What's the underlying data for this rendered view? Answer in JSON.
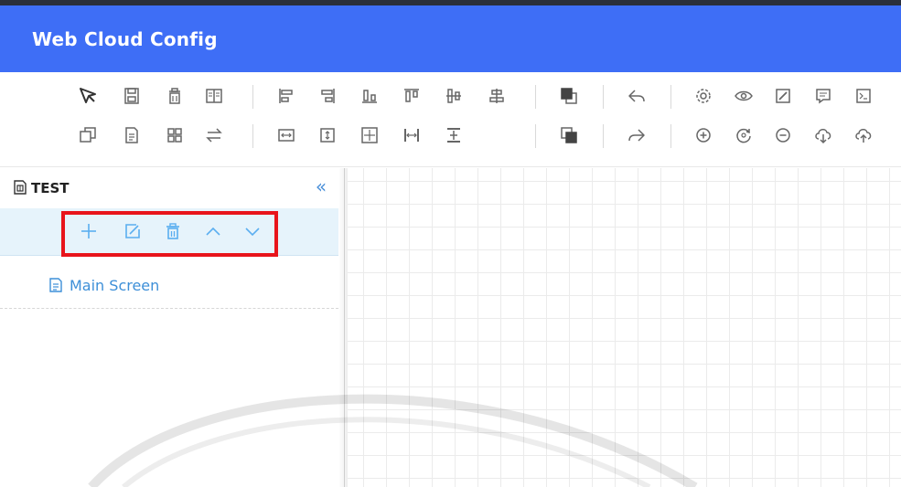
{
  "app": {
    "title": "Web Cloud Config",
    "accent": "#3e6ef6"
  },
  "toolbar": {
    "row1": [
      "select-pointer-icon",
      "save-icon",
      "delete-icon",
      "book-icon",
      "align-left-icon",
      "align-right-icon",
      "align-bottom-icon",
      "align-top-icon",
      "align-center-vertical-icon",
      "align-center-horizontal-icon",
      "bring-to-front-icon",
      "undo-icon",
      "settings-icon",
      "preview-eye-icon",
      "edit-icon",
      "comment-icon",
      "terminal-icon"
    ],
    "row2": [
      "copy-icon",
      "document-icon",
      "grid-icon",
      "swap-icon",
      "same-width-icon",
      "same-height-icon",
      "same-size-icon",
      "distribute-horizontal-icon",
      "distribute-vertical-icon",
      "send-to-back-icon",
      "redo-icon",
      "zoom-in-icon",
      "rotate-icon",
      "zoom-out-icon",
      "download-cloud-icon",
      "upload-cloud-icon"
    ]
  },
  "sidebar": {
    "project_name": "TEST",
    "collapse_glyph": "«",
    "actions": [
      "add-icon",
      "edit-icon",
      "delete-icon",
      "move-up-icon",
      "move-down-icon"
    ],
    "action_color": "#5aaef0",
    "highlight_color": "#e8141b",
    "screens": [
      {
        "label": "Main Screen"
      }
    ]
  }
}
